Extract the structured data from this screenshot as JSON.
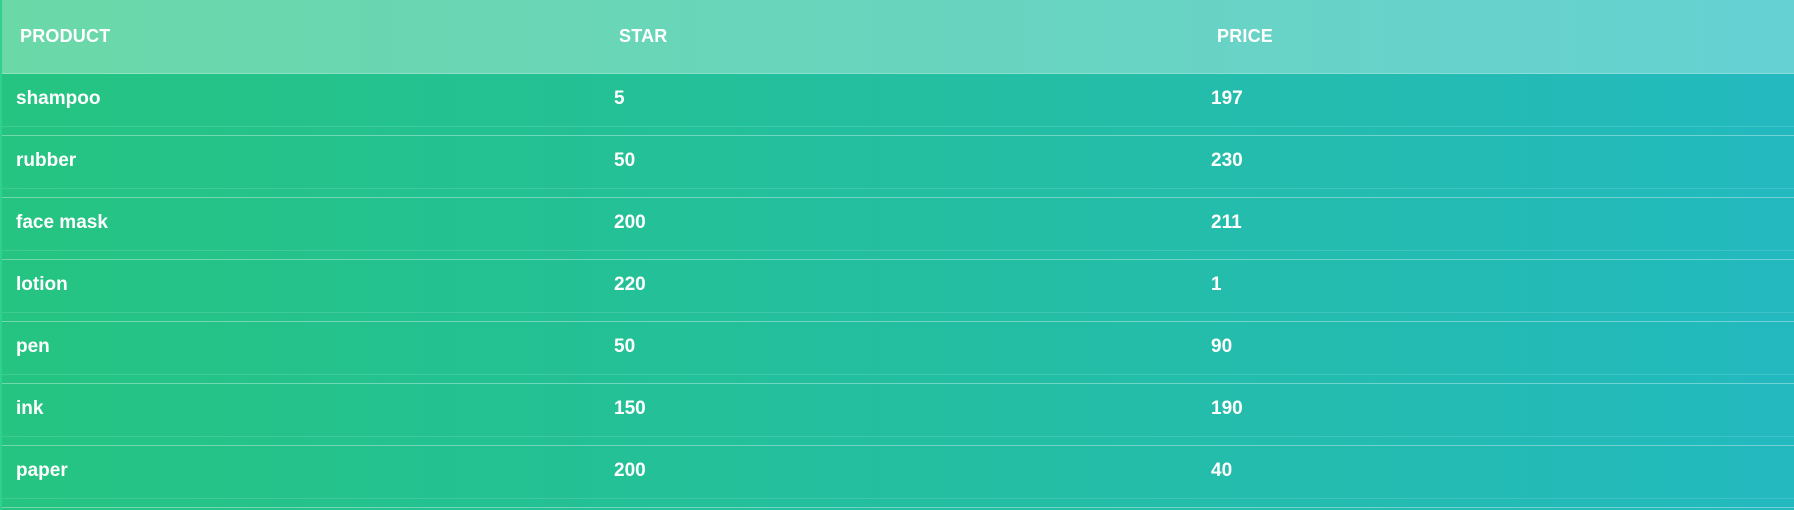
{
  "table": {
    "headers": [
      "PRODUCT",
      "STAR",
      "PRICE"
    ],
    "rows": [
      [
        "shampoo",
        "5",
        "197"
      ],
      [
        "rubber",
        "50",
        "230"
      ],
      [
        "face mask",
        "200",
        "211"
      ],
      [
        "lotion",
        "220",
        "1"
      ],
      [
        "pen",
        "50",
        "90"
      ],
      [
        "ink",
        "150",
        "190"
      ],
      [
        "paper",
        "200",
        "40"
      ]
    ]
  },
  "colors": {
    "body_gradient_start": "#25c481",
    "body_gradient_end": "#23b9bf",
    "header_gradient_start": "#6bd8a8",
    "header_gradient_end": "#66d1d3",
    "text": "#ffffff"
  }
}
